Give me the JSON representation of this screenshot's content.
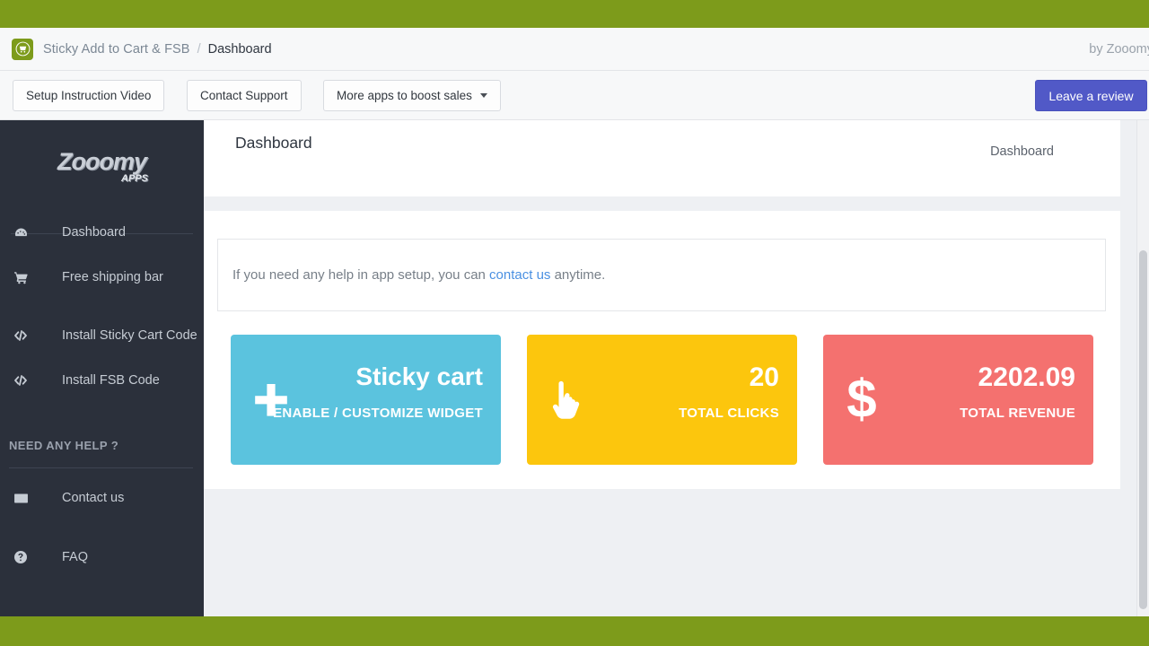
{
  "colors": {
    "green_bar": "#7d9b1b",
    "sidebar_bg": "#2b303b",
    "accent_blue": "#5159c7",
    "card_blue": "#5bc3de",
    "card_yellow": "#fcc60d",
    "card_red": "#f4716f",
    "link_blue": "#4a90e2"
  },
  "breadcrumb": {
    "app_icon": "shopping-cart-badge-icon",
    "app_name": "Sticky Add to Cart & FSB",
    "separator": "/",
    "current": "Dashboard",
    "byline": "by Zooomy"
  },
  "toolbar": {
    "setup_video_label": "Setup Instruction Video",
    "contact_support_label": "Contact Support",
    "more_apps_label": "More apps to boost sales",
    "more_apps_caret": "chevron-down-icon",
    "review_label": "Leave a review"
  },
  "sidebar": {
    "logo_text": "Zooomy",
    "logo_sub": "APPS",
    "items": [
      {
        "label": "Dashboard",
        "icon": "speedometer-icon"
      },
      {
        "label": "Free shipping bar",
        "icon": "shopping-cart-icon"
      },
      {
        "label": "Install Sticky Cart Code",
        "icon": "code-icon"
      },
      {
        "label": "Install FSB Code",
        "icon": "code-icon"
      }
    ],
    "help_title": "NEED ANY HELP ?",
    "help_items": [
      {
        "label": "Contact us",
        "icon": "envelope-icon"
      },
      {
        "label": "FAQ",
        "icon": "question-circle-icon"
      }
    ]
  },
  "page": {
    "title": "Dashboard",
    "crumb": "Dashboard"
  },
  "notice": {
    "prefix": "If you need any help in app setup, you can ",
    "link": "contact us",
    "suffix": " anytime."
  },
  "cards": [
    {
      "id": "sticky-cart",
      "icon": "plus-icon",
      "value": "Sticky cart",
      "label": "ENABLE / CUSTOMIZE WIDGET",
      "color": "#5bc3de"
    },
    {
      "id": "total-clicks",
      "icon": "pointing-hand-icon",
      "value": "20",
      "label": "TOTAL CLICKS",
      "color": "#fcc60d"
    },
    {
      "id": "total-revenue",
      "icon": "dollar-sign-icon",
      "value": "2202.09",
      "label": "TOTAL REVENUE",
      "color": "#f4716f"
    }
  ]
}
